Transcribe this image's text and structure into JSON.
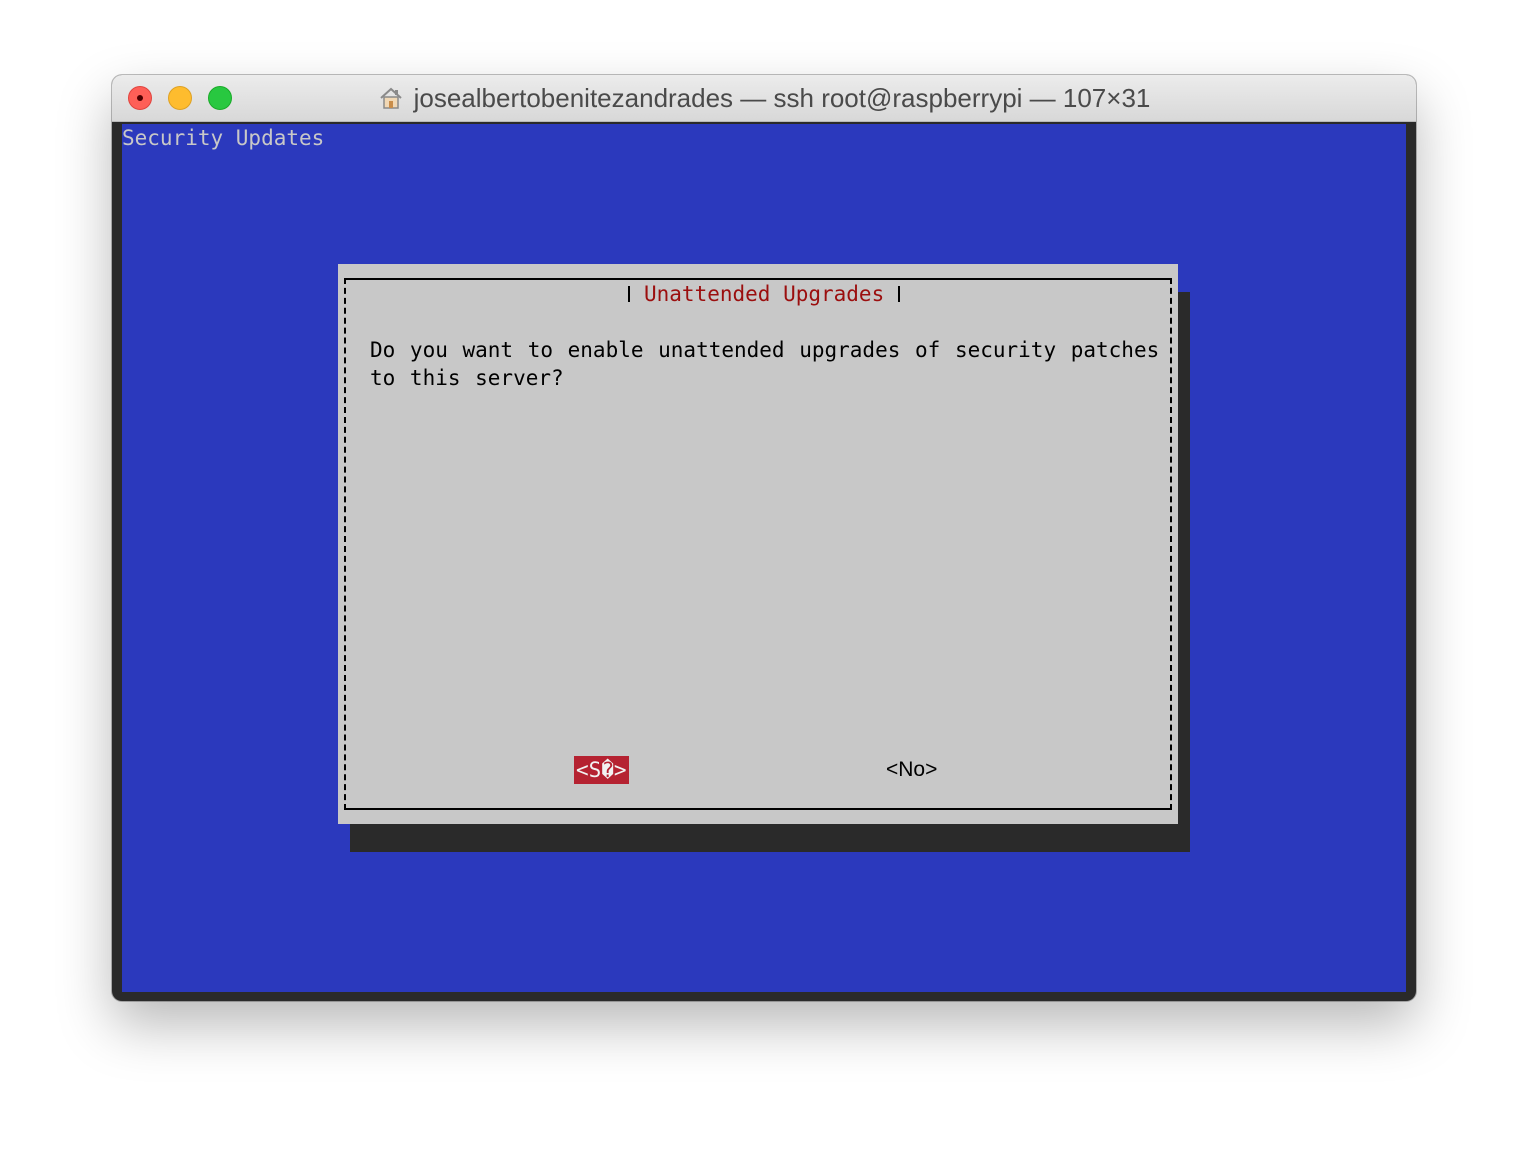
{
  "window": {
    "title": "josealbertobenitezandrades — ssh root@raspberrypi — 107×31",
    "title_icon": "home-icon"
  },
  "terminal": {
    "backtitle": "Security Updates",
    "dialog": {
      "title": "Unattended Upgrades",
      "message": "Do you want to enable unattended upgrades of security patches to this server?",
      "yes_label": "<S�>",
      "no_label": "<No>"
    }
  },
  "colors": {
    "terminal_background": "#2b39bd",
    "dialog_background": "#c8c8c8",
    "dialog_title": "#9b0e0e",
    "selected_button": "#b52231",
    "dialog_shadow": "#2a2a2a"
  }
}
